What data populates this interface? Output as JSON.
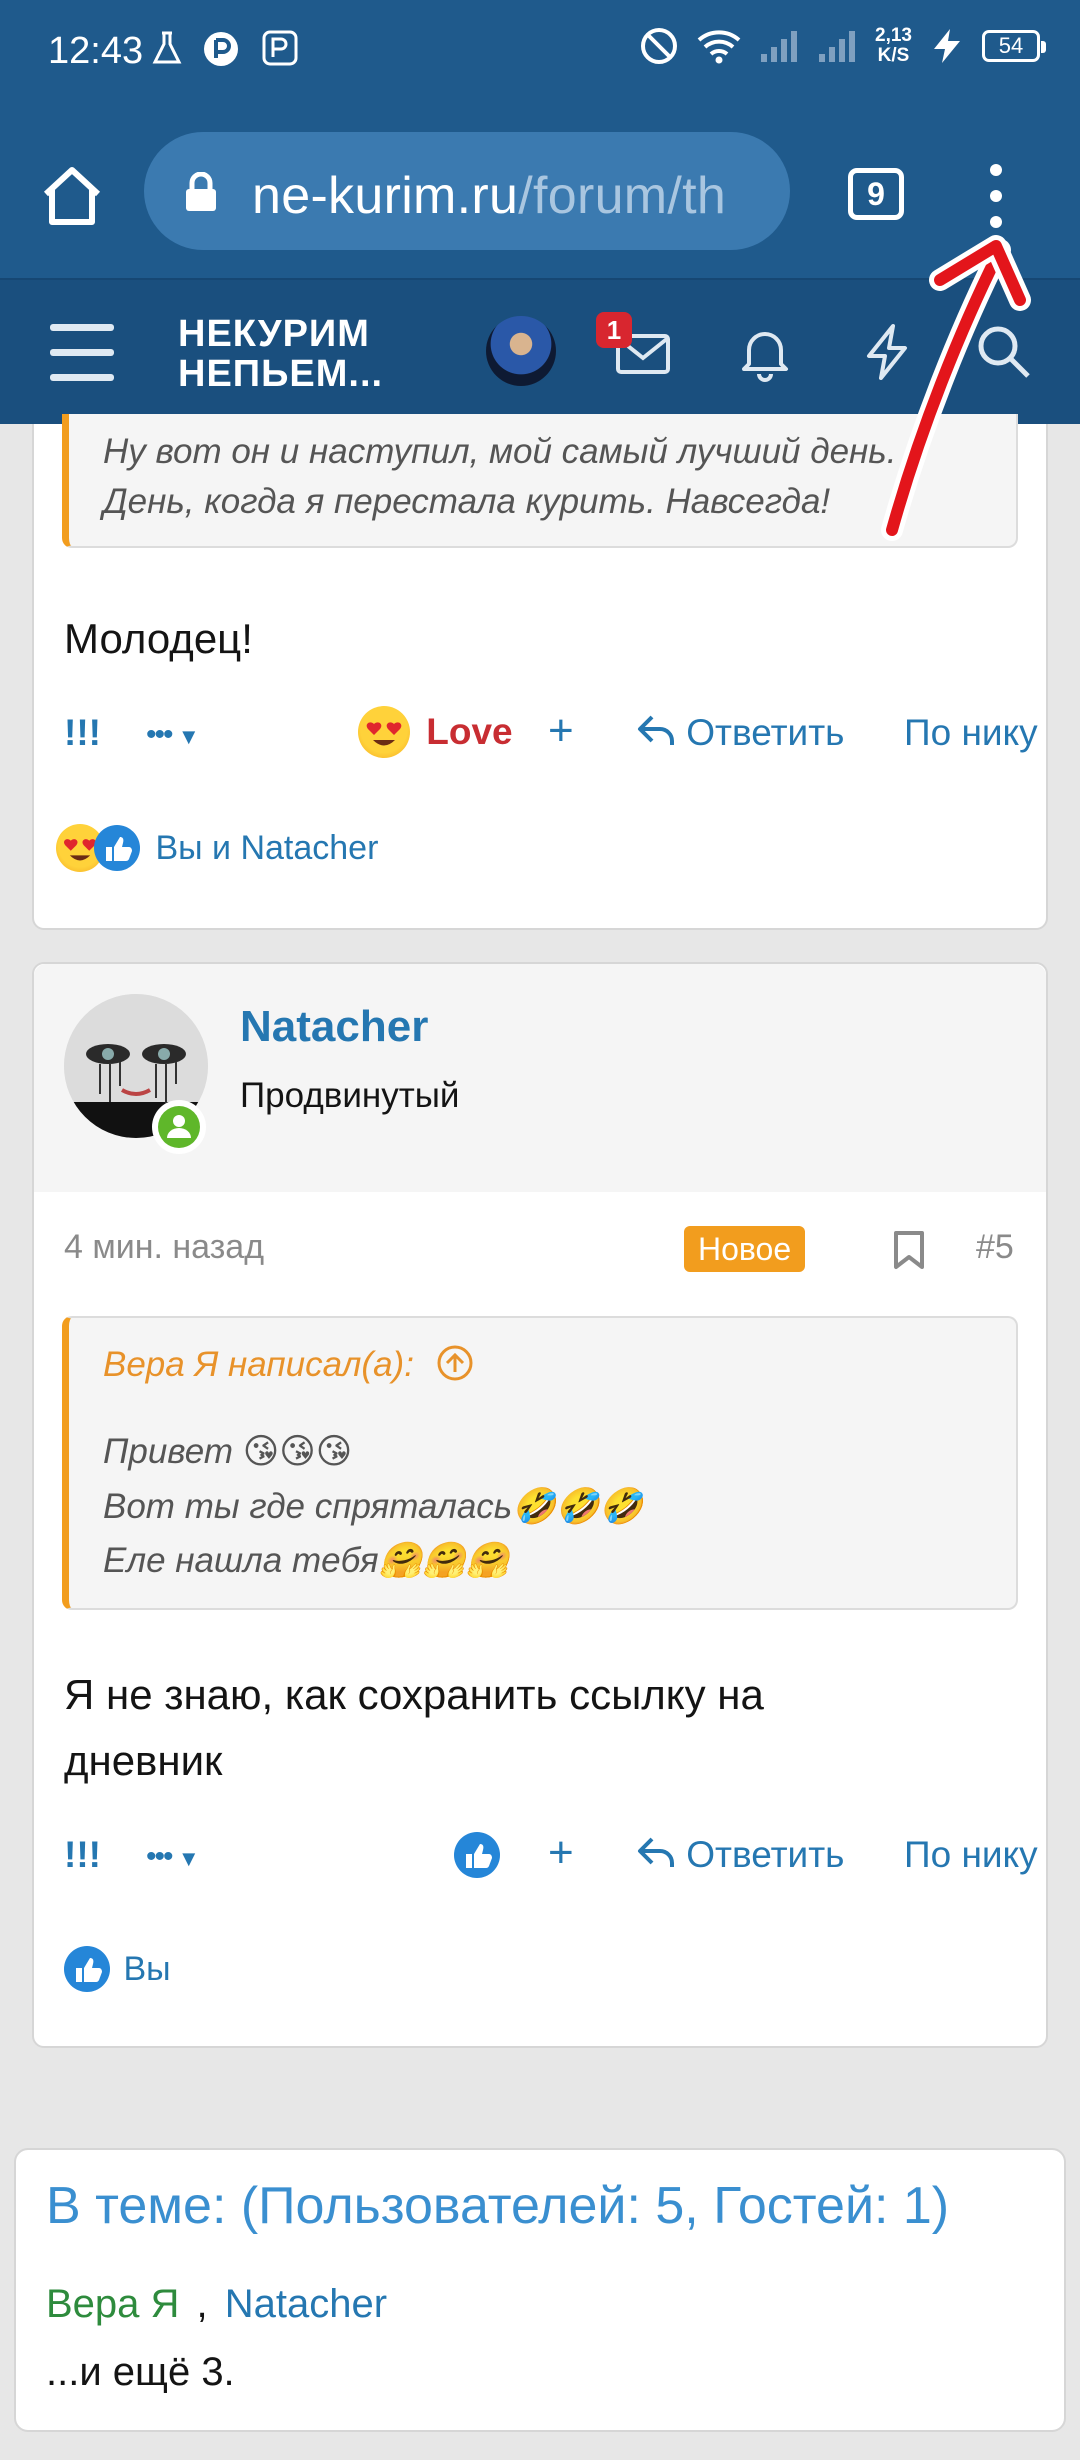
{
  "status_bar": {
    "time": "12:43",
    "net_speed": "2,13",
    "net_unit": "K/S",
    "battery": "54"
  },
  "browser": {
    "url_host": "ne-kurim.ru",
    "url_path": "/forum/th",
    "tab_count": "9"
  },
  "forum_nav": {
    "logo_line1": "НЕКУРИМ",
    "logo_line2": "НЕПЬЕМ...",
    "inbox_badge": "1"
  },
  "post1": {
    "quote_lines": [
      "Ну вот он и наступил, мой самый лучший день.",
      "День, когда я перестала курить. Навсегда!"
    ],
    "message": "Молодец!",
    "report_label": "!!!",
    "more_label": "•••",
    "reaction_label": "Love",
    "plus_label": "+",
    "reply_label": "Ответить",
    "quote_nick_label": "По нику",
    "reacted_text": "Вы и Natacher"
  },
  "post2": {
    "username": "Natacher",
    "user_title": "Продвинутый",
    "time": "4 мин. назад",
    "new_badge": "Новое",
    "post_number": "#5",
    "quote_author": "Вера Я написал(а):",
    "quote_lines": [
      "Привет 😘😘😘",
      "Вот ты где спряталась🤣🤣🤣",
      "Еле нашла тебя🤗🤗🤗"
    ],
    "message_line1": "Я не знаю, как сохранить ссылку на",
    "message_line2": "дневник",
    "report_label": "!!!",
    "more_label": "•••",
    "plus_label": "+",
    "reply_label": "Ответить",
    "quote_nick_label": "По нику",
    "reacted_text": "Вы"
  },
  "online": {
    "title": "В теме: (Пользователей: 5, Гостей: 1)",
    "user1": "Вера Я",
    "separator": ",",
    "user2": "Natacher",
    "more": "...и ещё 3."
  },
  "colors": {
    "chrome": "#1f5a8c",
    "forum_nav": "#1a4f7e",
    "link": "#2577b1",
    "quote_accent": "#f29d1e",
    "love": "#c82d32",
    "online_green": "#2e8b3d"
  }
}
